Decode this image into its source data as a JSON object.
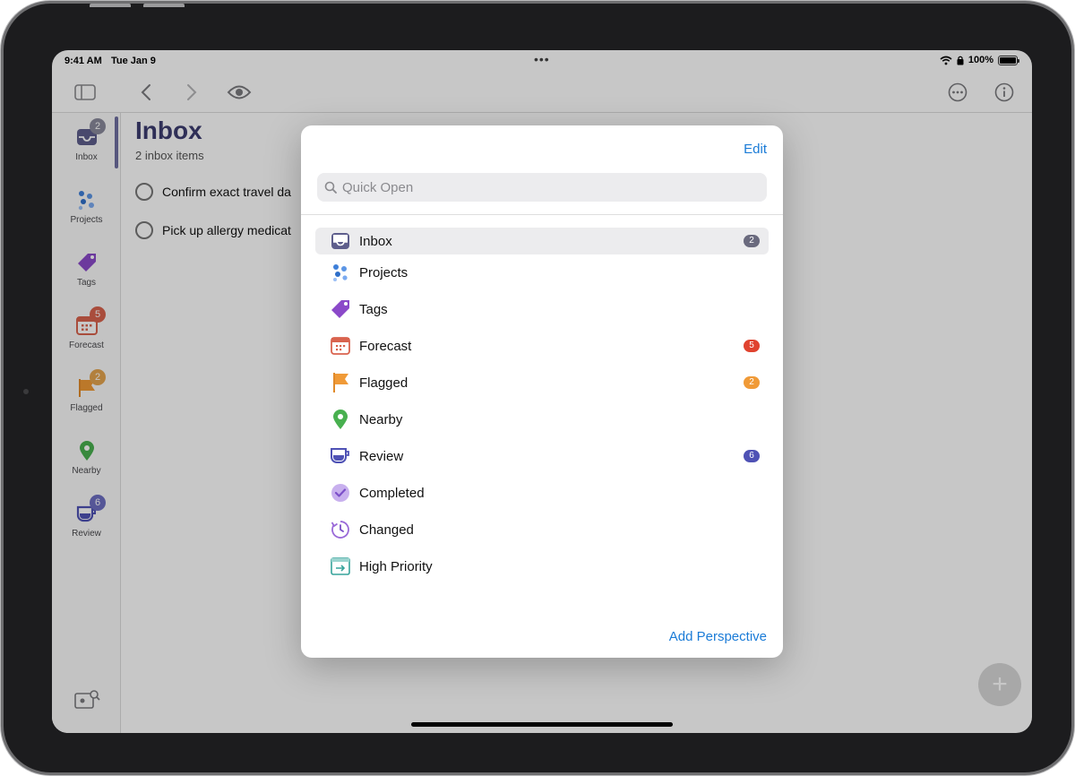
{
  "status_bar": {
    "time": "9:41 AM",
    "date": "Tue Jan 9",
    "battery": "100%"
  },
  "colors": {
    "accent": "#1a7bd7",
    "inbox": "#5e5e8c",
    "projects": "#3e7fd9",
    "tags": "#8b49c9",
    "forecast_badge": "#e0432f",
    "flagged": "#f09a37",
    "nearby": "#48b04f",
    "review": "#4f52b5",
    "completed": "#9a6ad8",
    "high_priority": "#37a39b"
  },
  "toolbar": {
    "icons": [
      "sidebar-icon",
      "back-chevron-icon",
      "forward-chevron-icon",
      "eye-icon",
      "more-icon",
      "info-icon"
    ]
  },
  "sidebar": {
    "items": [
      {
        "label": "Inbox",
        "badge": "2"
      },
      {
        "label": "Projects",
        "badge": ""
      },
      {
        "label": "Tags",
        "badge": ""
      },
      {
        "label": "Forecast",
        "badge": "5"
      },
      {
        "label": "Flagged",
        "badge": "2"
      },
      {
        "label": "Nearby",
        "badge": ""
      },
      {
        "label": "Review",
        "badge": "6"
      }
    ]
  },
  "main": {
    "title": "Inbox",
    "subtitle": "2 inbox items",
    "tasks": [
      {
        "text": "Confirm exact travel da"
      },
      {
        "text": "Pick up allergy medicat"
      }
    ]
  },
  "popover": {
    "edit_label": "Edit",
    "search_placeholder": "Quick Open",
    "items": [
      {
        "label": "Inbox",
        "badge": "2",
        "icon": "inbox-icon",
        "selected": true
      },
      {
        "label": "Projects",
        "badge": "",
        "icon": "projects-icon"
      },
      {
        "label": "Tags",
        "badge": "",
        "icon": "tag-icon"
      },
      {
        "label": "Forecast",
        "badge": "5",
        "icon": "calendar-icon"
      },
      {
        "label": "Flagged",
        "badge": "2",
        "icon": "flag-icon"
      },
      {
        "label": "Nearby",
        "badge": "",
        "icon": "location-pin-icon"
      },
      {
        "label": "Review",
        "badge": "6",
        "icon": "review-cup-icon"
      },
      {
        "label": "Completed",
        "badge": "",
        "icon": "checkmark-circle-icon"
      },
      {
        "label": "Changed",
        "badge": "",
        "icon": "clock-arrow-icon"
      },
      {
        "label": "High Priority",
        "badge": "",
        "icon": "high-priority-icon"
      }
    ],
    "add_label": "Add Perspective"
  }
}
